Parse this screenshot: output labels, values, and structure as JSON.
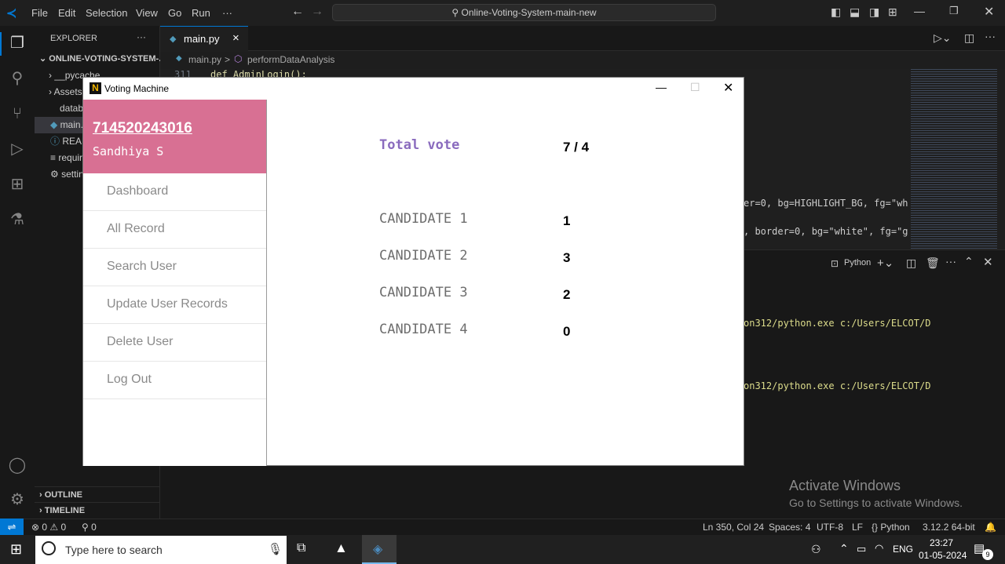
{
  "vscode": {
    "menu": [
      "File",
      "Edit",
      "Selection",
      "View",
      "Go",
      "Run",
      "···"
    ],
    "command_center": "Online-Voting-System-main-new",
    "explorer_title": "EXPLORER",
    "explorer_more": "···",
    "project_root": "ONLINE-VOTING-SYSTEM-...",
    "tree": [
      "__pycache__",
      "Assets",
      "database",
      "main.py",
      "README.md",
      "requirements.txt",
      "settings"
    ],
    "outline": "OUTLINE",
    "timeline": "TIMELINE",
    "tab": {
      "label": "main.py",
      "close": "×"
    },
    "breadcrumb": {
      "file": "main.py",
      "sep": ">",
      "symbol": "performDataAnalysis"
    },
    "code": {
      "line_no": "311",
      "line_text": "def AdminLogin():",
      "snippet1": "er=0, bg=HIGHLIGHT_BG, fg=\"wh",
      "snippet2": ", border=0, bg=\"white\", fg=\"g"
    },
    "terminal": {
      "shell": "Python",
      "line1": "on312/python.exe c:/Users/ELCOT/D",
      "line2": "on312/python.exe c:/Users/ELCOT/D"
    },
    "statusbar": {
      "problems": "⊗ 0 ⚠ 0",
      "ports": "⚲ 0",
      "position": "Ln 350, Col 24",
      "spaces": "Spaces: 4",
      "encoding": "UTF-8",
      "eol": "LF",
      "language": "{} Python",
      "interpreter": "3.12.2 64-bit"
    },
    "colors": {
      "accent": "#0078d4",
      "bg": "#1f1f1f"
    }
  },
  "watermark": {
    "title": "Activate Windows",
    "subtitle": "Go to Settings to activate Windows."
  },
  "taskbar": {
    "search_placeholder": "Type here to search",
    "language": "ENG",
    "time": "23:27",
    "date": "01-05-2024",
    "notifications": "9"
  },
  "voting_window": {
    "title": "Voting Machine",
    "user_id": "714520243016",
    "user_name": "Sandhiya S",
    "menu": [
      "Dashboard",
      "All Record",
      "Search User",
      "Update User Records",
      "Delete User",
      "Log Out"
    ],
    "total_label": "Total vote",
    "total_value": "7 / 4",
    "candidates": [
      {
        "label": "CANDIDATE 1",
        "votes": "1"
      },
      {
        "label": "CANDIDATE 2",
        "votes": "3"
      },
      {
        "label": "CANDIDATE 3",
        "votes": "2"
      },
      {
        "label": "CANDIDATE 4",
        "votes": "0"
      }
    ],
    "colors": {
      "header": "#d87093",
      "total_label": "#8a6bbe"
    }
  }
}
